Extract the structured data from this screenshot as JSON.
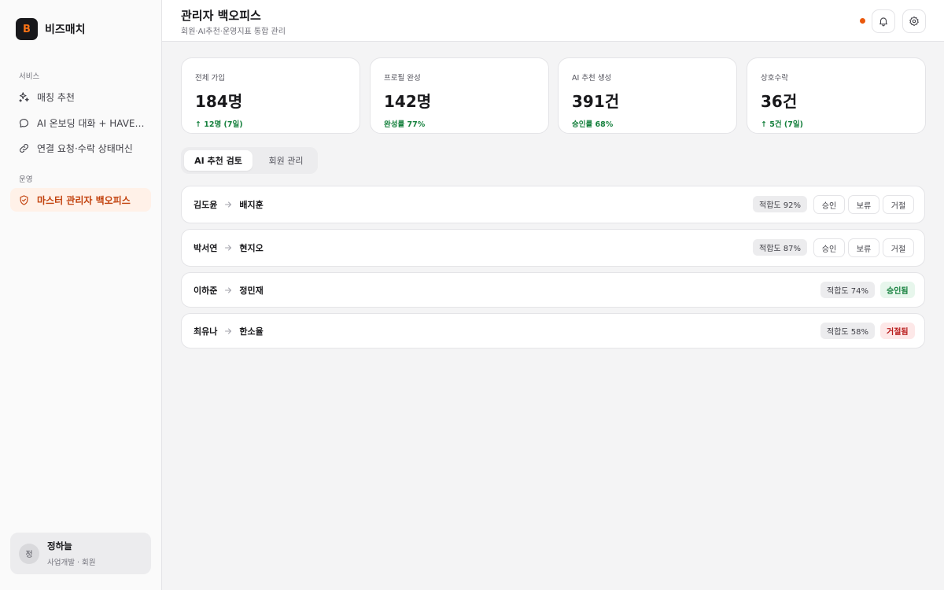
{
  "brand": {
    "logo_letter": "B",
    "name": "비즈매치"
  },
  "sidebar": {
    "section_service": "서비스",
    "section_ops": "운영",
    "items": [
      {
        "label": "매칭 추천",
        "icon": "sparkles-icon"
      },
      {
        "label": "AI 온보딩 대화 + HAVE·WANT",
        "icon": "chat-bubble-icon"
      },
      {
        "label": "연결 요청·수락 상태머신",
        "icon": "link-icon"
      },
      {
        "label": "마스터 관리자 백오피스",
        "icon": "shield-icon",
        "active": true
      }
    ],
    "user": {
      "initial": "정",
      "name": "정하늘",
      "sub": "사업개발 · 회원"
    }
  },
  "header": {
    "title": "관리자 백오피스",
    "subtitle": "회원·AI추천·운영지표 통합 관리",
    "status_color": "#ea580c"
  },
  "stats": [
    {
      "label": "전체 가입",
      "value": "184명",
      "delta": "↑ 12명 (7일)"
    },
    {
      "label": "프로필 완성",
      "value": "142명",
      "delta": "완성률 77%"
    },
    {
      "label": "AI 추천 생성",
      "value": "391건",
      "delta": "승인률 68%"
    },
    {
      "label": "상호수락",
      "value": "36건",
      "delta": "↑ 5건 (7일)"
    }
  ],
  "tabs": {
    "active": "AI 추천 검토",
    "inactive": "회원 관리"
  },
  "rows": [
    {
      "from": "김도윤",
      "to": "배지훈",
      "fit": "적합도 92%",
      "approve": "승인",
      "hold": "보류",
      "reject": "거절"
    },
    {
      "from": "박서연",
      "to": "현지오",
      "fit": "적합도 87%",
      "approve": "승인",
      "hold": "보류",
      "reject": "거절"
    },
    {
      "from": "이하준",
      "to": "정민재",
      "fit": "적합도 74%",
      "status": "승인됨"
    },
    {
      "from": "최유나",
      "to": "한소율",
      "fit": "적합도 58%",
      "status": "거절됨"
    }
  ],
  "colors": {
    "accent": "#ea580c",
    "success": "#15803d",
    "danger": "#b91c1c"
  }
}
